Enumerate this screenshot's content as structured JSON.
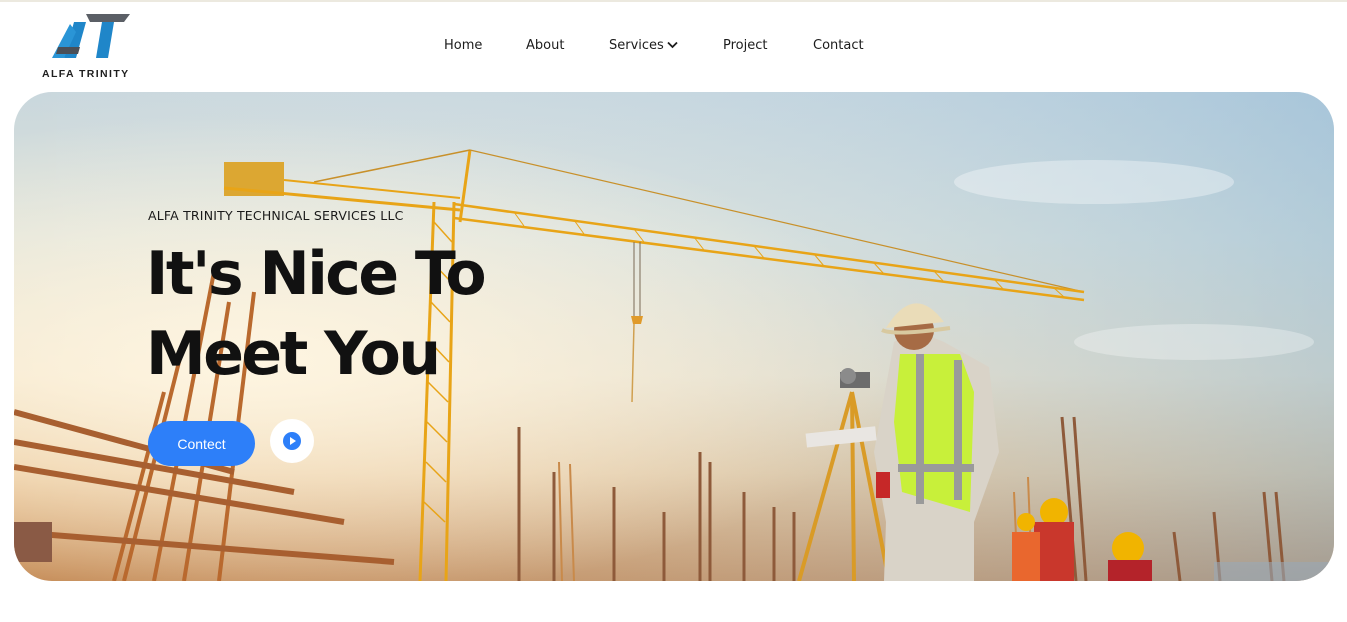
{
  "header": {
    "logo_text": "ALFA TRINITY",
    "nav": [
      {
        "label": "Home"
      },
      {
        "label": "About"
      },
      {
        "label": "Services"
      },
      {
        "label": "Project"
      },
      {
        "label": "Contact"
      }
    ]
  },
  "hero": {
    "eyebrow": "ALFA TRINITY TECHNICAL SERVICES LLC",
    "headline_line1": "It's Nice To",
    "headline_line2": "Meet You",
    "cta_label": "Contect",
    "play_icon": "play-icon"
  },
  "colors": {
    "accent": "#2d7ff9",
    "logo_blue": "#1f86c9",
    "logo_gray": "#5b5f66"
  }
}
